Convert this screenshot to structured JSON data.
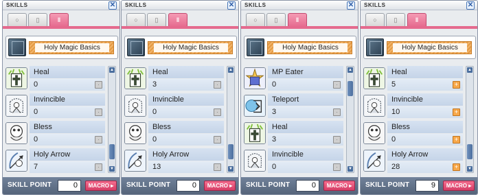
{
  "panels": [
    {
      "title": "SKILLS",
      "close_glyph": "✕",
      "tabs": [
        "○",
        "▯",
        "‖"
      ],
      "job": "Holy Magic Basics",
      "skills": [
        {
          "name": "Heal",
          "level": "0",
          "icon": "heal-icon",
          "can_add": false
        },
        {
          "name": "Invincible",
          "level": "0",
          "icon": "invincible-icon",
          "can_add": false
        },
        {
          "name": "Bless",
          "level": "0",
          "icon": "bless-icon",
          "can_add": false
        },
        {
          "name": "Holy Arrow",
          "level": "7",
          "icon": "holy-arrow-icon",
          "can_add": false
        }
      ],
      "scroll_position": 0.9,
      "skill_point_label": "SKILL POINT",
      "skill_point": "0",
      "macro_label": "MACRO ▸"
    },
    {
      "title": "SKILLS",
      "close_glyph": "✕",
      "tabs": [
        "○",
        "▯",
        "‖"
      ],
      "job": "Holy Magic Basics",
      "skills": [
        {
          "name": "Heal",
          "level": "3",
          "icon": "heal-icon",
          "can_add": false
        },
        {
          "name": "Invincible",
          "level": "0",
          "icon": "invincible-icon",
          "can_add": false
        },
        {
          "name": "Bless",
          "level": "0",
          "icon": "bless-icon",
          "can_add": false
        },
        {
          "name": "Holy Arrow",
          "level": "13",
          "icon": "holy-arrow-icon",
          "can_add": false
        }
      ],
      "scroll_position": 0.9,
      "skill_point_label": "SKILL POINT",
      "skill_point": "0",
      "macro_label": "MACRO ▸"
    },
    {
      "title": "SKILLS",
      "close_glyph": "✕",
      "tabs": [
        "○",
        "▯",
        "‖"
      ],
      "job": "Holy Magic Basics",
      "skills": [
        {
          "name": "MP Eater",
          "level": "0",
          "icon": "mp-eater-icon",
          "can_add": false
        },
        {
          "name": "Teleport",
          "level": "3",
          "icon": "teleport-icon",
          "can_add": false
        },
        {
          "name": "Heal",
          "level": "3",
          "icon": "heal-icon",
          "can_add": false
        },
        {
          "name": "Invincible",
          "level": "0",
          "icon": "invincible-icon",
          "can_add": false
        }
      ],
      "scroll_position": 0.1,
      "skill_point_label": "SKILL POINT",
      "skill_point": "0",
      "macro_label": "MACRO ▸"
    },
    {
      "title": "SKILLS",
      "close_glyph": "✕",
      "tabs": [
        "○",
        "▯",
        "‖"
      ],
      "job": "Holy Magic Basics",
      "skills": [
        {
          "name": "Heal",
          "level": "5",
          "icon": "heal-icon",
          "can_add": true
        },
        {
          "name": "Invincible",
          "level": "10",
          "icon": "invincible-icon",
          "can_add": true
        },
        {
          "name": "Bless",
          "level": "0",
          "icon": "bless-icon",
          "can_add": true
        },
        {
          "name": "Holy Arrow",
          "level": "28",
          "icon": "holy-arrow-icon",
          "can_add": true
        }
      ],
      "scroll_position": 0.9,
      "skill_point_label": "SKILL POINT",
      "skill_point": "9",
      "macro_label": "MACRO ▸"
    }
  ]
}
